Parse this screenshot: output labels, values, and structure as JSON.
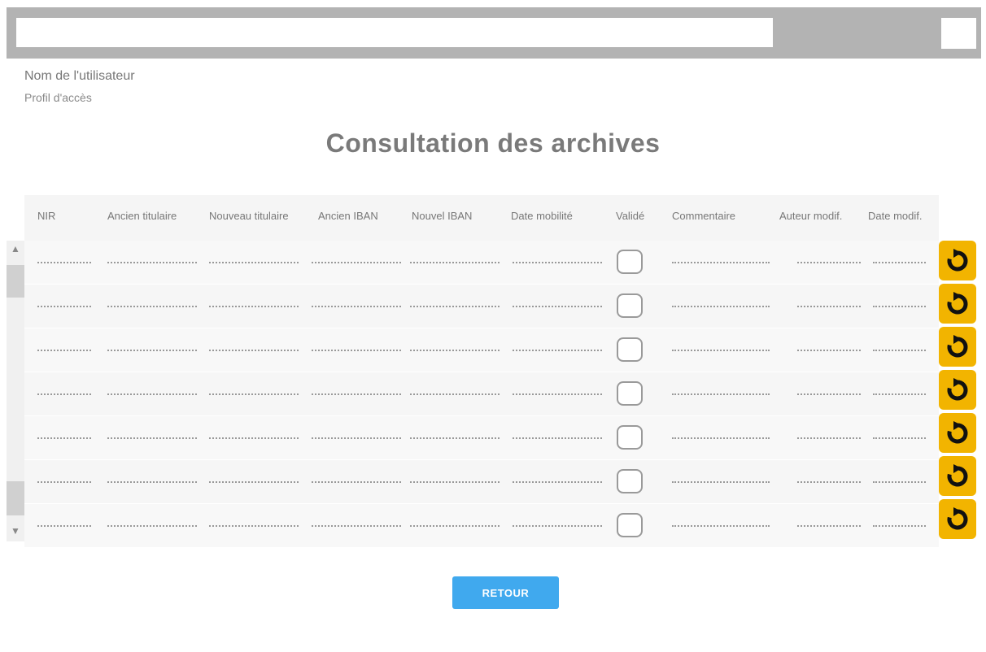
{
  "header_bar": {
    "search_value": "",
    "action_value": ""
  },
  "user": {
    "name": "Nom de l'utilisateur",
    "profile": "Profil d'accès"
  },
  "page": {
    "title": "Consultation des archives"
  },
  "table": {
    "columns": [
      "NIR",
      "Ancien titulaire",
      "Nouveau titulaire",
      "Ancien IBAN",
      "Nouvel IBAN",
      "Date mobilité",
      "Validé",
      "Commentaire",
      "Auteur modif.",
      "Date modif."
    ],
    "row_count": 7
  },
  "actions": {
    "retour_label": "RETOUR"
  },
  "scroll": {
    "up_glyph": "▲",
    "down_glyph": "▼"
  },
  "colors": {
    "undo": "#f2b400",
    "retour": "#40a9ee",
    "topbar": "#b3b3b3"
  },
  "icons": {
    "row_action": "undo-icon",
    "scroll_up": "scroll-up-arrow-icon",
    "scroll_down": "scroll-down-arrow-icon"
  }
}
